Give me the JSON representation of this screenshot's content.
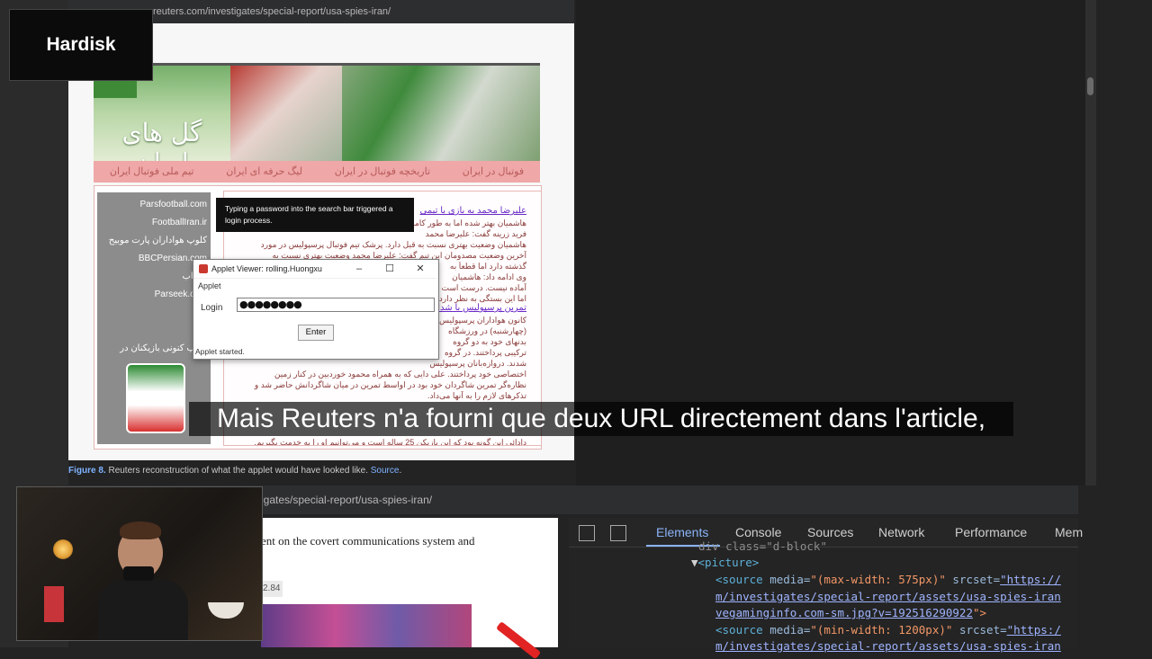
{
  "overlay": {
    "logo": "Hardisk"
  },
  "upper": {
    "url": "reuters.com/investigates/special-report/usa-spies-iran/",
    "banner": {
      "title": "گل های ایران",
      "nav": [
        "فوتبال در ایران",
        "تاریخچه فوتبال در ایران",
        "لیگ حرفه ای ایران",
        "تیم ملی فوتبال ایران"
      ]
    },
    "sidebar_links": [
      "Parsfootball.com",
      "FootballIran.ir",
      "کلوپ هواداران پارت موبیح",
      "BBCPersian.com",
      "انتخاب",
      "Parseek.com",
      "",
      "",
      "کلوپ کنونی بازیکنان در"
    ],
    "article": {
      "headline": "علیرضا محمد به بازی با تیمی",
      "link2": "تمرین پرسپولیس با شدایی",
      "lines": [
        "هاشمیان بهتر شده اما به طور کامل",
        "فرید زرینه گفت: علیرضا محمد",
        "هاشمیان وضعیت بهتری نسبت به قبل دارد.  پرشک تیم فوتبال پرسپولیس  در مورد",
        "آخرین وضعیت مصدومان این تیم گفت: علیرضا محمد وضعیت بهتری نسبت به",
        "گذشته دارد اما قطعاً به",
        "وی ادامه داد: هاشمیان",
        "آماده نیست. درست است",
        "اما این بستگی به نظر دارد",
        "",
        "کانون هواداران پرسپولیس",
        "(چهارشنبه) در ورزشگاه",
        "بدنهای خود به دو گروه",
        "ترکیبی پرداختند. در گروه",
        "شدند.  دروازه‌بانان پرسپولیس",
        "اختصاصی خود پرداختند.  علی دایی که به همراه محمود خوردبین در کنار زمین",
        "نظاره‌گر تمرین شاگردان خود بود در اواسط تمرین در میان شاگردانش حاضر شد و",
        "تذکرهای لازم را به آنها می‌داد.",
        "",
        "",
        "دادائی این گونه بود که این بازیکن 25 ساله است و می‌توانیم او را به خدمت بگیریم."
      ]
    },
    "tooltip": "Typing a password into the search bar triggered a login process.",
    "applet": {
      "title": "Applet Viewer: rolling.Huongxu",
      "menu": "Applet",
      "login_label": "Login",
      "password_mask": "●●●●●●●●",
      "enter_label": "Enter",
      "status": "Applet started."
    },
    "caption": {
      "figure": "Figure 8.",
      "text": " Reuters reconstruction of what the applet would have looked like. ",
      "source": "Source"
    }
  },
  "subtitle": "Mais Reuters n'a fourni que deux URL directement dans l'article,",
  "lower": {
    "url": "igates/special-report/usa-spies-iran/",
    "text": "ent on the covert communications system and",
    "number": "2.84",
    "devtools": {
      "tabs": [
        "Elements",
        "Console",
        "Sources",
        "Network",
        "Performance",
        "Mem"
      ],
      "lines": {
        "l0": "div class=\"d-block\"",
        "l1_tag": "<picture>",
        "l2_tag": "<source ",
        "l2_attr1": "media=",
        "l2_val1": "\"(max-width: 575px)\"",
        "l2_attr2": " srcset=",
        "l2_val2": "\"https://",
        "l3": "m/investigates/special-report/assets/usa-spies-iran",
        "l4": "vegaminginfo.com-sm.jpg?v=192516290922",
        "l4_end": "\">",
        "l5_tag": "<source ",
        "l5_attr1": "media=",
        "l5_val1": "\"(min-width: 1200px)\"",
        "l5_attr2": " srcset=",
        "l5_val2": "\"https:/",
        "l6": "m/investigates/special-report/assets/usa-spies-iran"
      }
    }
  }
}
